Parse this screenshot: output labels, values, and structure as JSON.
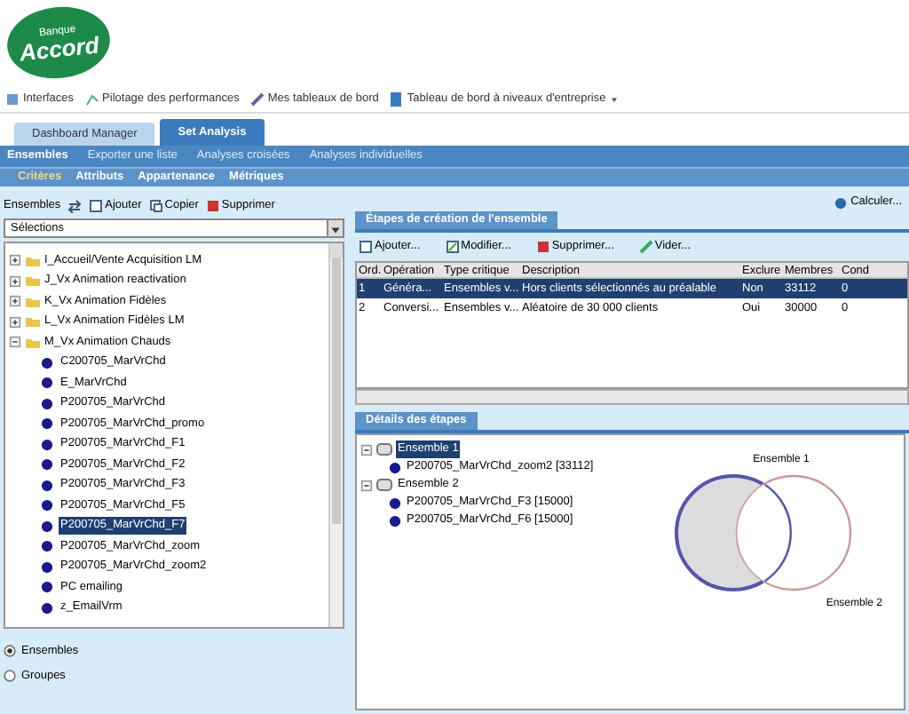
{
  "logo": {
    "small": "Banque",
    "big": "Accord"
  },
  "toolbar": [
    {
      "label": "Interfaces"
    },
    {
      "label": "Pilotage des performances"
    },
    {
      "label": "Mes tableaux de bord"
    },
    {
      "label": "Tableau de bord à niveaux d'entreprise",
      "dropdown": true
    }
  ],
  "tabs": [
    {
      "label": "Dashboard Manager",
      "selected": false
    },
    {
      "label": "Set Analysis",
      "selected": true
    }
  ],
  "nav": [
    {
      "label": "Ensembles",
      "selected": true
    },
    {
      "label": "Exporter une liste",
      "selected": false
    },
    {
      "label": "Analyses croisées",
      "selected": false
    },
    {
      "label": "Analyses individuelles",
      "selected": false
    }
  ],
  "subnav": [
    {
      "label": "Critères",
      "selected": true
    },
    {
      "label": "Attributs",
      "selected": false
    },
    {
      "label": "Appartenance",
      "selected": false
    },
    {
      "label": "Métriques",
      "selected": false
    }
  ],
  "left": {
    "label": "Ensembles",
    "actions": [
      "Ajouter",
      "Copier",
      "Supprimer"
    ],
    "dropdown": "Sélections",
    "tree": [
      {
        "label": "I_Accueil/Vente Acquisition LM",
        "expanded": false
      },
      {
        "label": "J_Vx Animation reactivation",
        "expanded": false
      },
      {
        "label": "K_Vx Animation Fidèles",
        "expanded": false
      },
      {
        "label": "L_Vx Animation Fidèles LM",
        "expanded": false
      },
      {
        "label": "M_Vx Animation Chauds",
        "expanded": true,
        "children": [
          {
            "label": "C200705_MarVrChd",
            "selected": false
          },
          {
            "label": "E_MarVrChd",
            "selected": false
          },
          {
            "label": "P200705_MarVrChd",
            "selected": false
          },
          {
            "label": "P200705_MarVrChd_promo",
            "selected": false
          },
          {
            "label": "P200705_MarVrChd_F1",
            "selected": false
          },
          {
            "label": "P200705_MarVrChd_F2",
            "selected": false
          },
          {
            "label": "P200705_MarVrChd_F3",
            "selected": false
          },
          {
            "label": "P200705_MarVrChd_F5",
            "selected": false
          },
          {
            "label": "P200705_MarVrChd_F7",
            "selected": true
          },
          {
            "label": "P200705_MarVrChd_zoom",
            "selected": false
          },
          {
            "label": "P200705_MarVrChd_zoom2",
            "selected": false
          },
          {
            "label": "PC emailing",
            "selected": false
          },
          {
            "label": "z_EmailVrm",
            "selected": false
          }
        ]
      }
    ],
    "radios": [
      {
        "label": "Ensembles",
        "selected": true
      },
      {
        "label": "Groupes",
        "selected": false
      }
    ]
  },
  "calc": "Calculer...",
  "steps": {
    "title": "Étapes de création de l'ensemble",
    "actions": [
      "Ajouter...",
      "Modifier...",
      "Supprimer...",
      "Vider..."
    ],
    "columns": [
      "Ord.",
      "Opération",
      "Type critique",
      "Description",
      "Exclure",
      "Membres",
      "Cond"
    ],
    "rows": [
      {
        "selected": true,
        "cells": [
          "1",
          "Généra...",
          "Ensembles v...",
          "Hors clients sélectionnés au préalable",
          "Non",
          "33112",
          "0"
        ]
      },
      {
        "selected": false,
        "cells": [
          "2",
          "Conversi...",
          "Ensembles v...",
          "Aléatoire de 30 000 clients",
          "Oui",
          "30000",
          "0"
        ]
      }
    ]
  },
  "details": {
    "title": "Détails des étapes",
    "tree": [
      {
        "label": "Ensemble 1",
        "selected": true,
        "children": [
          {
            "label": "P200705_MarVrChd_zoom2 [33112]"
          }
        ]
      },
      {
        "label": "Ensemble 2",
        "selected": false,
        "children": [
          {
            "label": "P200705_MarVrChd_F3 [15000]"
          },
          {
            "label": "P200705_MarVrChd_F6 [15000]"
          }
        ]
      }
    ],
    "venn": [
      "Ensemble 1",
      "Ensemble 2"
    ]
  }
}
